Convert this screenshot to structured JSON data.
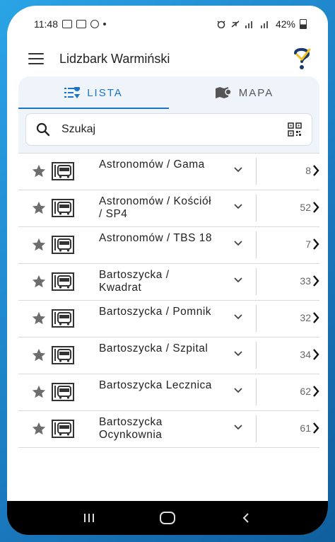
{
  "status_bar": {
    "time": "11:48",
    "battery": "42%"
  },
  "app_bar": {
    "title": "Lidzbark Warmiński"
  },
  "tabs": [
    {
      "label": "LISTA",
      "active": true,
      "icon": "list-pin-icon"
    },
    {
      "label": "MAPA",
      "active": false,
      "icon": "map-pin-icon"
    }
  ],
  "search": {
    "placeholder": "Szukaj"
  },
  "stops": [
    {
      "name": "Astronomów / Gama",
      "count": "8"
    },
    {
      "name": "Astronomów / Kościół / SP4",
      "count": "52"
    },
    {
      "name": "Astronomów / TBS 18",
      "count": "7"
    },
    {
      "name": "Bartoszycka / Kwadrat",
      "count": "33"
    },
    {
      "name": "Bartoszycka / Pomnik",
      "count": "32"
    },
    {
      "name": "Bartoszycka / Szpital",
      "count": "34"
    },
    {
      "name": "Bartoszycka Lecznica",
      "count": "62"
    },
    {
      "name": "Bartoszycka Ocynkownia",
      "count": "61"
    }
  ],
  "colors": {
    "accent": "#1b74c9",
    "frame": "#1f86c9",
    "card_bg": "#eef4fa"
  }
}
